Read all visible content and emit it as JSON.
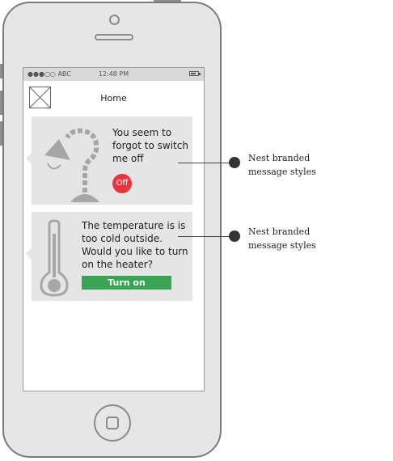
{
  "status_bar": {
    "carrier": "●●●○○ ABC",
    "time": "12:48 PM"
  },
  "nav": {
    "title": "Home"
  },
  "cards": [
    {
      "message": "You seem to forgot to switch me off",
      "button": "Off",
      "button_color": "#e8343f"
    },
    {
      "message": "The temperature is is too cold outside. Would you like to turn on the heater?",
      "button": "Turn on",
      "button_color": "#3aa455"
    }
  ],
  "annotations": [
    {
      "label_line1": "Nest branded",
      "label_line2": "message styles"
    },
    {
      "label_line1": "Nest branded",
      "label_line2": "message styles"
    }
  ],
  "icons": [
    "image-placeholder-icon",
    "lamp-icon",
    "thermometer-icon",
    "battery-icon"
  ]
}
